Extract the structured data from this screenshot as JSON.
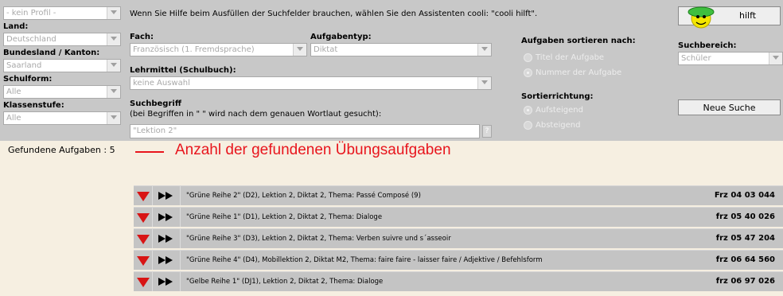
{
  "profile": {
    "value": "- kein Profil -"
  },
  "help_text": "Wenn Sie Hilfe beim Ausfüllen der Suchfelder brauchen, wählen Sie den Assistenten cooli: \"cooli hilft\".",
  "cooli_button": {
    "label": "hilft"
  },
  "land": {
    "label": "Land:",
    "value": "Deutschland"
  },
  "bundesland": {
    "label": "Bundesland / Kanton:",
    "value": "Saarland"
  },
  "schulform": {
    "label": "Schulform:",
    "value": "Alle"
  },
  "klassenstufe": {
    "label": "Klassenstufe:",
    "value": "Alle"
  },
  "fach": {
    "label": "Fach:",
    "value": "Französisch (1. Fremdsprache)"
  },
  "aufgabentyp": {
    "label": "Aufgabentyp:",
    "value": "Diktat"
  },
  "lehrmittel": {
    "label": "Lehrmittel (Schulbuch):",
    "value": "keine Auswahl"
  },
  "suchbegriff": {
    "label": "Suchbegriff",
    "hint": "(bei Begriffen in \" \" wird nach dem genauen Wortlaut gesucht):",
    "value": "\"Lektion 2\"",
    "help": "?"
  },
  "sortieren": {
    "label": "Aufgaben sortieren nach:",
    "options": [
      "Titel der Aufgabe",
      "Nummer der Aufgabe"
    ],
    "selected": 1
  },
  "richtung": {
    "label": "Sortierrichtung:",
    "options": [
      "Aufsteigend",
      "Absteigend"
    ],
    "selected": 0
  },
  "suchbereich": {
    "label": "Suchbereich:",
    "value": "Schüler"
  },
  "neue_suche": {
    "label": "Neue Suche"
  },
  "results": {
    "count_label": "Gefundene Aufgaben : 5",
    "annotation": "Anzahl der gefundenen Übungsaufgaben",
    "rows": [
      {
        "title": "\"Grüne Reihe 2\" (D2), Lektion 2, Diktat 2, Thema: Passé Composé (9)",
        "code": "Frz 04 03 044"
      },
      {
        "title": "\"Grüne Reihe 1\" (D1), Lektion 2, Diktat 2, Thema: Dialoge",
        "code": "frz 05 40 026"
      },
      {
        "title": "\"Grüne Reihe 3\" (D3), Lektion 2, Diktat 2, Thema: Verben suivre und s´asseoir",
        "code": "frz 05 47 204"
      },
      {
        "title": "\"Grüne Reihe 4\" (D4), Mobillektion 2, Diktat M2, Thema: faire faire - laisser faire / Adjektive / Befehlsform",
        "code": "frz 06 64 560"
      },
      {
        "title": "\"Gelbe Reihe 1\" (DJ1), Lektion 2, Diktat 2, Thema: Dialoge",
        "code": "frz 06 97 026"
      }
    ]
  },
  "colors": {
    "accent_red": "#e8151d",
    "panel_gray": "#c8c8c8",
    "background": "#f6efe1",
    "row_gray": "#c4c4c4"
  }
}
